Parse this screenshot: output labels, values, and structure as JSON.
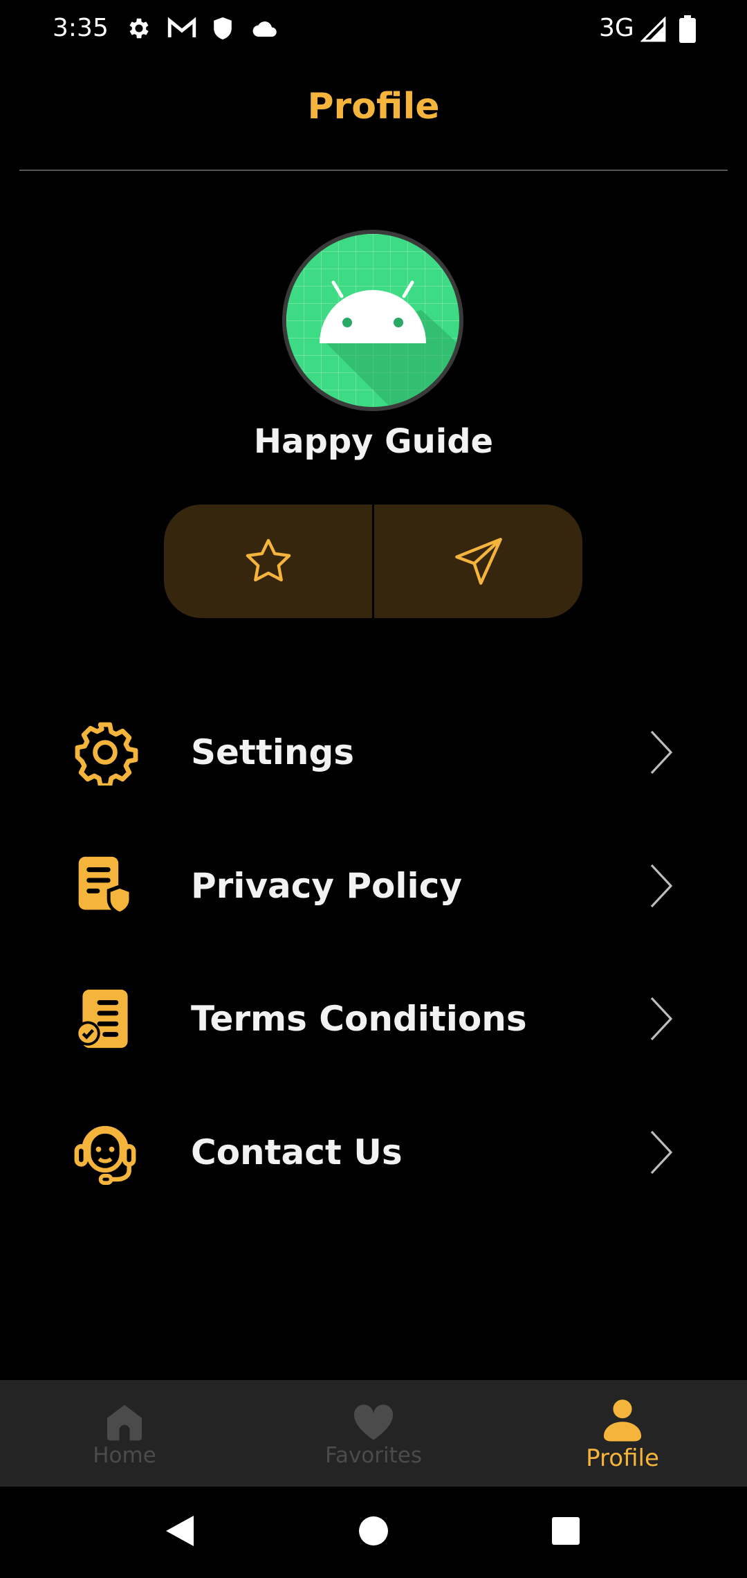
{
  "status_bar": {
    "time": "3:35",
    "network": "3G",
    "icons": [
      "gear-icon",
      "gmail-icon",
      "shield-icon",
      "cloud-icon",
      "signal-icon",
      "battery-icon"
    ]
  },
  "header": {
    "title": "Profile"
  },
  "profile": {
    "name": "Happy Guide",
    "avatar_icon": "android-icon",
    "actions": [
      {
        "icon": "star-icon"
      },
      {
        "icon": "send-icon"
      }
    ]
  },
  "menu": {
    "items": [
      {
        "label": "Settings",
        "icon": "gear-icon"
      },
      {
        "label": "Privacy Policy",
        "icon": "privacy-document-icon"
      },
      {
        "label": "Terms Conditions",
        "icon": "terms-document-icon"
      },
      {
        "label": "Contact Us",
        "icon": "headset-icon"
      }
    ]
  },
  "bottom_nav": {
    "tabs": [
      {
        "label": "Home",
        "icon": "home-icon",
        "active": false
      },
      {
        "label": "Favorites",
        "icon": "heart-icon",
        "active": false
      },
      {
        "label": "Profile",
        "icon": "person-icon",
        "active": true
      }
    ]
  },
  "colors": {
    "accent": "#f5b43c",
    "background": "#000000",
    "pill_background": "#35260d",
    "nav_background": "#242424",
    "avatar_green": "#3ddc84"
  }
}
